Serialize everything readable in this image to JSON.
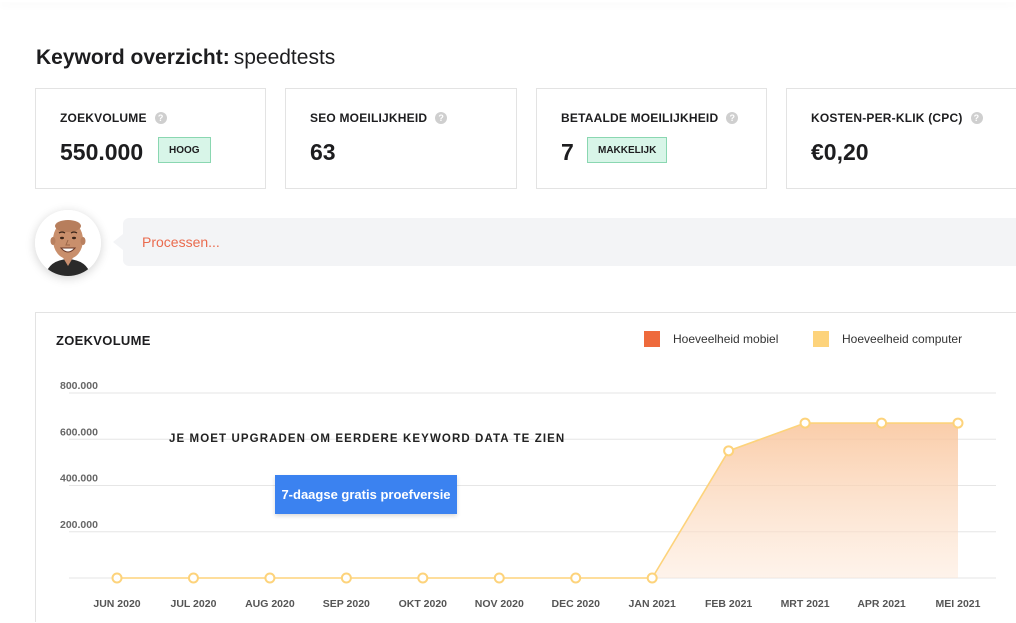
{
  "overview": {
    "title_label": "Keyword overzicht:",
    "keyword": "speedtests"
  },
  "stats": [
    {
      "label": "ZOEKVOLUME",
      "value": "550.000",
      "badge": "HOOG"
    },
    {
      "label": "SEO MOEILIJKHEID",
      "value": "63"
    },
    {
      "label": "BETAALDE MOEILIJKHEID",
      "value": "7",
      "badge": "MAKKELIJK"
    },
    {
      "label": "KOSTEN-PER-KLIK (CPC)",
      "value": "€0,20"
    }
  ],
  "help_icon_glyph": "?",
  "assistant": {
    "status_text": "Processen..."
  },
  "volume_chart": {
    "title": "ZOEKVOLUME",
    "upgrade_message": "JE MOET UPGRADEN OM EERDERE KEYWORD DATA TE ZIEN",
    "trial_button_label": "7-daagse gratis proefversie"
  },
  "colors": {
    "mobile": "#ee6a3c",
    "computer": "#fdd37b",
    "badge_bg": "#d8f5e8",
    "badge_border": "#8ad7b1",
    "accent_blue": "#3b82f0",
    "status_text": "#ea6b4e"
  },
  "icons": [
    "help-icon",
    "avatar-photo"
  ],
  "chart_data": {
    "type": "area",
    "title": "ZOEKVOLUME",
    "categories": [
      "JUN 2020",
      "JUL 2020",
      "AUG 2020",
      "SEP 2020",
      "OKT 2020",
      "NOV 2020",
      "DEC 2020",
      "JAN 2021",
      "FEB 2021",
      "MRT 2021",
      "APR 2021",
      "MEI 2021"
    ],
    "y_ticks": [
      "200.000",
      "400.000",
      "600.000",
      "800.000"
    ],
    "ylim": [
      0,
      800000
    ],
    "series": [
      {
        "name": "Hoeveelheid mobiel",
        "values": [
          0,
          0,
          0,
          0,
          0,
          0,
          0,
          0,
          0,
          0,
          0,
          0
        ]
      },
      {
        "name": "Hoeveelheid computer",
        "values": [
          0,
          0,
          0,
          0,
          0,
          0,
          0,
          0,
          550000,
          670000,
          670000,
          670000
        ]
      }
    ],
    "grid": true,
    "legend_position": "top-right"
  }
}
